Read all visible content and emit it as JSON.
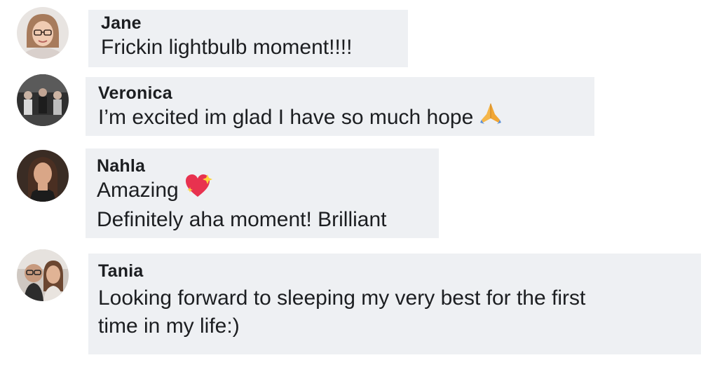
{
  "comments": [
    {
      "author": "Jane",
      "lines": [
        "Frickin lightbulb moment!!!!"
      ]
    },
    {
      "author": "Veronica",
      "lines": [
        "I’m excited im glad I have so much hope"
      ],
      "emoji": "folded-hands-icon"
    },
    {
      "author": "Nahla",
      "lines": [
        "Amazing",
        "Definitely aha moment! Brilliant"
      ],
      "emoji": "sparkling-heart-icon"
    },
    {
      "author": "Tania",
      "lines": [
        "Looking forward to sleeping my very best for the first",
        "time in my life:)"
      ]
    }
  ],
  "colors": {
    "bubble_bg": "#eef0f3",
    "text": "#1c1e21"
  }
}
